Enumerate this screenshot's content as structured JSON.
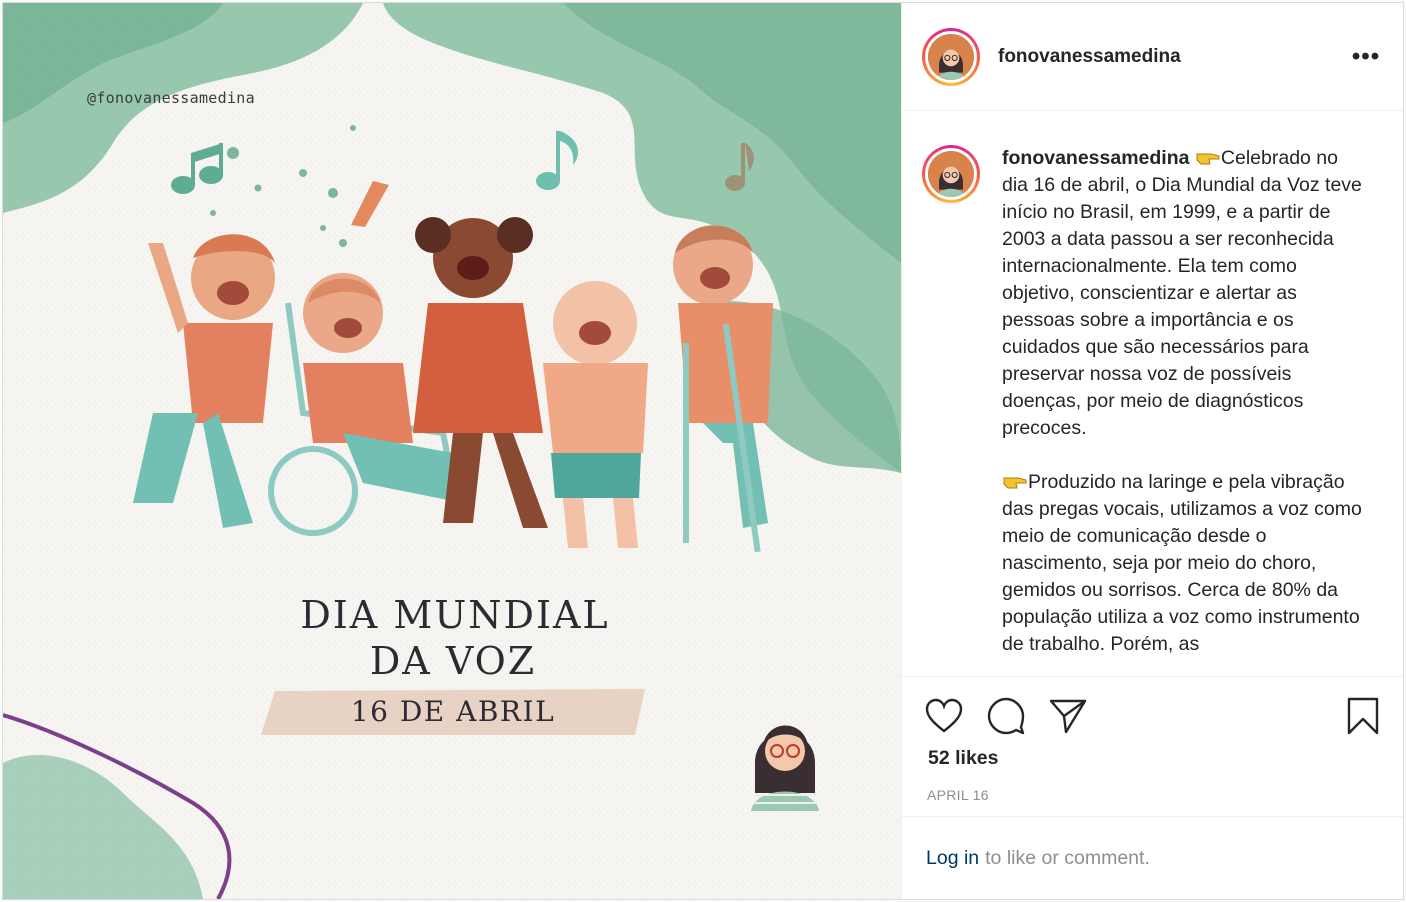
{
  "post": {
    "image": {
      "handle_text": "@fonovanessamedina",
      "title_line1": "DIA MUNDIAL",
      "title_line2": "DA VOZ",
      "date_text": "16 DE ABRIL",
      "colors": {
        "watercolor_green": "#7fb89a",
        "paper": "#f6f5f2",
        "band": "#e7d2c4",
        "swirl": "#7b3f8c"
      }
    },
    "header": {
      "username": "fonovanessamedina",
      "more_icon": "more-horizontal-icon"
    },
    "caption": {
      "username": "fonovanessamedina",
      "emoji": "backhand-index-pointing-right",
      "paragraph1": "Celebrado no dia 16 de abril, o Dia Mundial da Voz teve início no Brasil, em 1999, e a partir de 2003 a data passou a ser reconhecida internacionalmente. Ela tem como objetivo, conscientizar e alertar as pessoas sobre a importância e os cuidados que são necessários para preservar nossa voz de possíveis doenças, por meio de diagnósticos precoces.",
      "paragraph2": "Produzido na laringe e pela vibração das pregas vocais, utilizamos a voz como meio de comunicação desde o nascimento, seja por meio do choro, gemidos ou sorrisos. Cerca de 80% da população utiliza a voz como instrumento de trabalho. Porém, as"
    },
    "actions": {
      "icons": [
        "heart-icon",
        "comment-icon",
        "share-icon",
        "bookmark-icon"
      ],
      "likes_text": "52 likes",
      "date": "APRIL 16"
    },
    "login": {
      "link_text": "Log in",
      "rest_text": "to like or comment."
    }
  }
}
